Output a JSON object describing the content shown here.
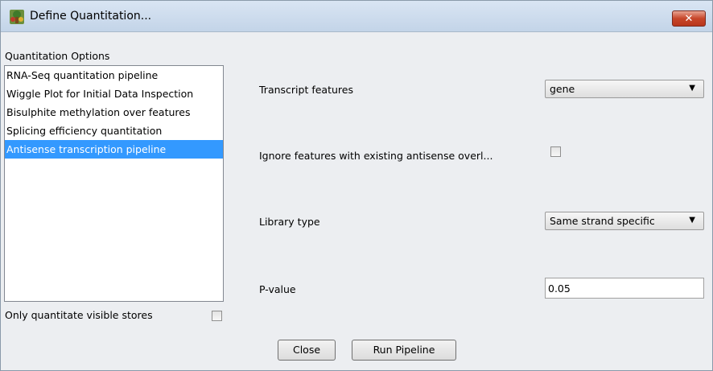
{
  "window": {
    "title": "Define Quantitation...",
    "close_glyph": "✕"
  },
  "options": {
    "header": "Quantitation Options",
    "items": [
      {
        "label": "RNA-Seq quantitation pipeline"
      },
      {
        "label": "Wiggle Plot for Initial Data Inspection"
      },
      {
        "label": "Bisulphite methylation over features"
      },
      {
        "label": "Splicing efficiency quantitation"
      },
      {
        "label": "Antisense transcription pipeline"
      }
    ],
    "selected_index": 4,
    "visible_stores_label": "Only quantitate visible stores",
    "visible_stores_checked": false
  },
  "settings": {
    "transcript_features_label": "Transcript features",
    "transcript_features_value": "gene",
    "ignore_overlap_label": "Ignore features with existing antisense overl...",
    "ignore_overlap_checked": false,
    "library_type_label": "Library type",
    "library_type_value": "Same strand specific",
    "pvalue_label": "P-value",
    "pvalue_value": "0.05"
  },
  "buttons": {
    "close": "Close",
    "run": "Run Pipeline"
  },
  "colors": {
    "selection": "#3399ff",
    "close_button": "#c7462a"
  },
  "icons": {
    "app": "app-tree-icon",
    "dropdown": "chevron-down-icon"
  }
}
